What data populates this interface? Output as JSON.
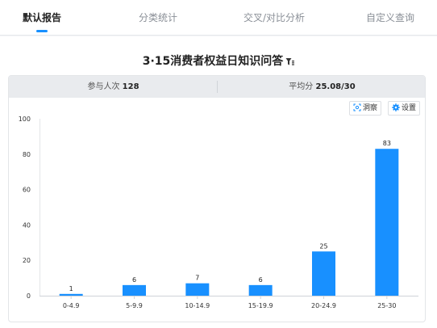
{
  "tabs": [
    {
      "label": "默认报告",
      "active": true
    },
    {
      "label": "分类统计",
      "active": false
    },
    {
      "label": "交叉/对比分析",
      "active": false
    },
    {
      "label": "自定义查询",
      "active": false
    }
  ],
  "title": "3·15消费者权益日知识问答",
  "summary": {
    "participants_label": "参与人次",
    "participants_value": "128",
    "average_label": "平均分",
    "average_value": "25.08/30"
  },
  "toolbar": {
    "insight_label": "洞察",
    "settings_label": "设置"
  },
  "colors": {
    "bar": "#1890ff",
    "accent": "#1890ff"
  },
  "chart_data": {
    "type": "bar",
    "categories": [
      "0-4.9",
      "5-9.9",
      "10-14.9",
      "15-19.9",
      "20-24.9",
      "25-30"
    ],
    "values": [
      1,
      6,
      7,
      6,
      25,
      83
    ],
    "ylim": [
      0,
      100
    ],
    "yticks": [
      0,
      20,
      40,
      60,
      80,
      100
    ],
    "grid": false,
    "legend": "none"
  }
}
